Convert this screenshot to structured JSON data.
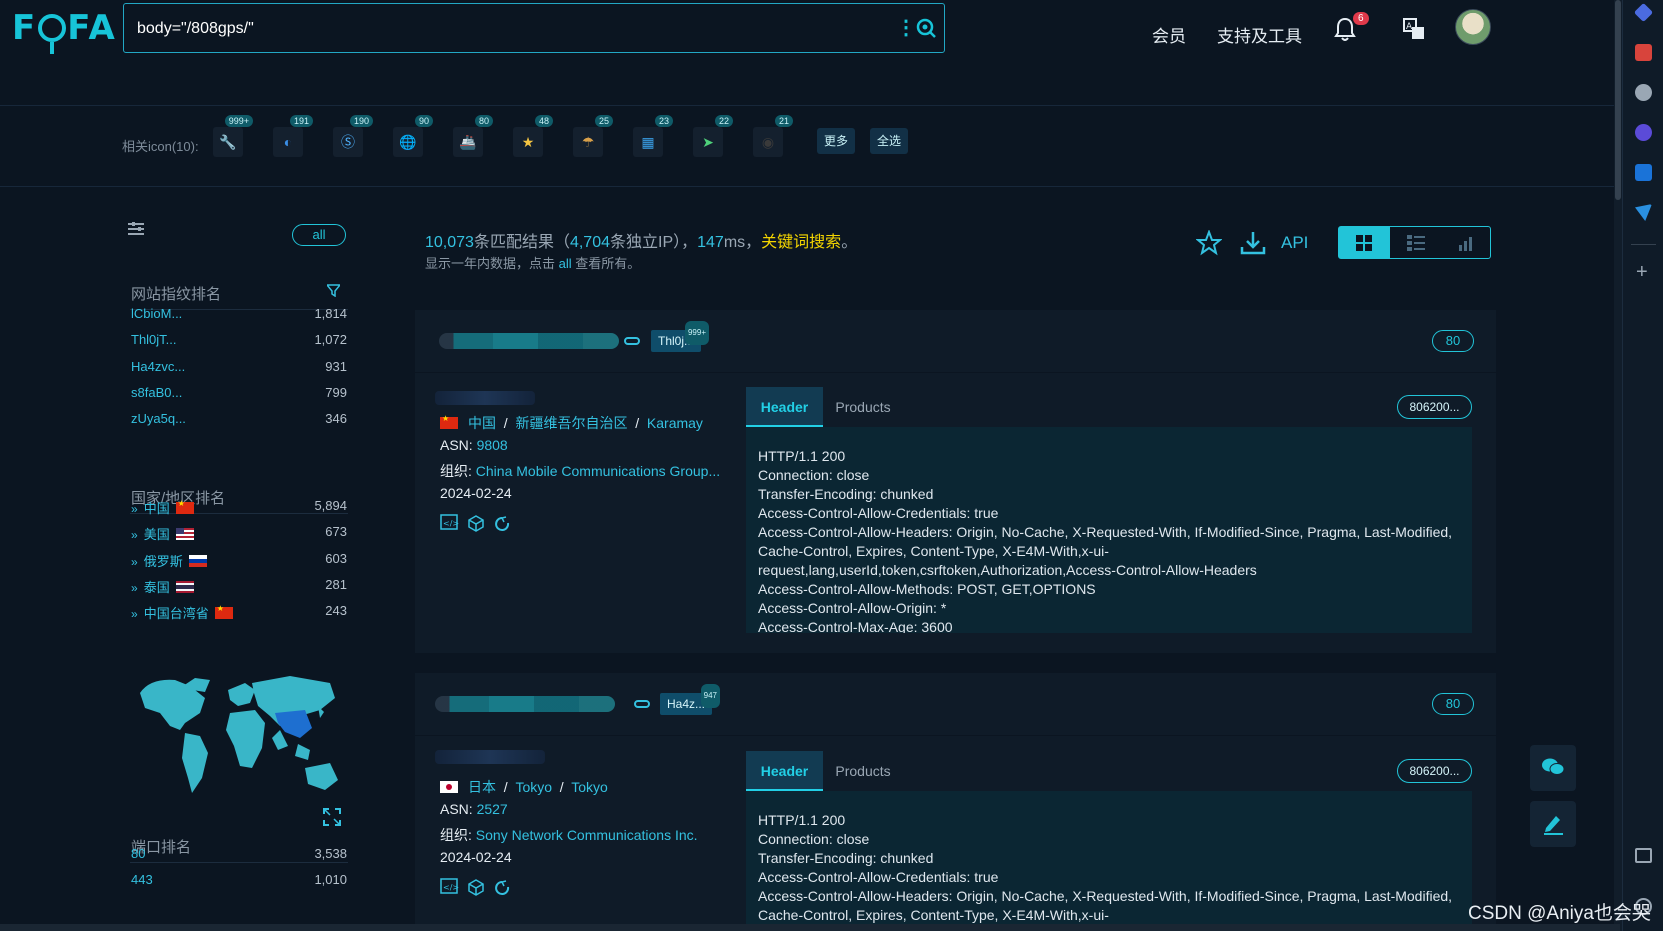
{
  "header": {
    "logo": "FOFA",
    "search_query": "body=\"/808gps/\"",
    "nav_member": "会员",
    "nav_tools": "支持及工具",
    "notification_count": "6"
  },
  "icon_strip": {
    "label": "相关icon(10):",
    "icons": [
      {
        "count": "999+",
        "glyph": "🔧",
        "color": "#c9d2dc"
      },
      {
        "count": "191",
        "glyph": "◐",
        "color": "#3a8ee6"
      },
      {
        "count": "190",
        "glyph": "Ⓢ",
        "color": "#4fb3ff"
      },
      {
        "count": "90",
        "glyph": "🌐",
        "color": "#4aa3df"
      },
      {
        "count": "80",
        "glyph": "🚢",
        "color": "#d94a4a"
      },
      {
        "count": "48",
        "glyph": "★",
        "color": "#f5c542"
      },
      {
        "count": "25",
        "glyph": "☂",
        "color": "#d8a04a"
      },
      {
        "count": "23",
        "glyph": "▦",
        "color": "#3aa0e8"
      },
      {
        "count": "22",
        "glyph": "➤",
        "color": "#4fd07a"
      },
      {
        "count": "21",
        "glyph": "◉",
        "color": "#3a3a3a"
      }
    ],
    "more_label": "更多",
    "select_all_label": "全选"
  },
  "sidebar": {
    "all_label": "all",
    "fingerprint_title": "网站指纹排名",
    "fingerprints": [
      {
        "name": "lCbioM...",
        "count": "1,814"
      },
      {
        "name": "Thl0jT...",
        "count": "1,072"
      },
      {
        "name": "Ha4zvc...",
        "count": "931"
      },
      {
        "name": "s8faB0...",
        "count": "799"
      },
      {
        "name": "zUya5q...",
        "count": "346"
      }
    ],
    "country_title": "国家/地区排名",
    "countries": [
      {
        "name": "中国",
        "count": "5,894",
        "flag": "cn"
      },
      {
        "name": "美国",
        "count": "673",
        "flag": "us"
      },
      {
        "name": "俄罗斯",
        "count": "603",
        "flag": "ru"
      },
      {
        "name": "泰国",
        "count": "281",
        "flag": "th"
      },
      {
        "name": "中国台湾省",
        "count": "243",
        "flag": "cn"
      }
    ],
    "port_title": "端口排名",
    "ports": [
      {
        "name": "80",
        "count": "3,538"
      },
      {
        "name": "443",
        "count": "1,010"
      }
    ]
  },
  "summary": {
    "total": "10,073",
    "total_suffix": "条匹配结果（",
    "ips": "4,704",
    "ips_suffix": "条独立IP），",
    "ms": "147",
    "ms_suffix": "ms，",
    "keyword_link": "关键词搜索",
    "end": "。",
    "note_prefix": "显示一年内数据，点击",
    "note_all": "all",
    "note_suffix": "查看所有。",
    "api_label": "API"
  },
  "results": [
    {
      "tag": "Thl0j...",
      "tag_count": "999+",
      "port": "80",
      "country": "中国",
      "region": "新疆维吾尔自治区",
      "city": "Karamay",
      "asn_label": "ASN:",
      "asn": "9808",
      "org_label": "组织:",
      "org": "China Mobile Communications Group...",
      "date": "2024-02-24",
      "tab_header": "Header",
      "tab_products": "Products",
      "hash": "806200...",
      "header_text": "HTTP/1.1 200\nConnection: close\nTransfer-Encoding: chunked\nAccess-Control-Allow-Credentials: true\nAccess-Control-Allow-Headers: Origin, No-Cache, X-Requested-With, If-Modified-Since, Pragma, Last-Modified, Cache-Control, Expires, Content-Type, X-E4M-With,x-ui-request,lang,userId,token,csrftoken,Authorization,Access-Control-Allow-Headers\nAccess-Control-Allow-Methods: POST, GET,OPTIONS\nAccess-Control-Allow-Origin: *\nAccess-Control-Max-Age: 3600"
    },
    {
      "tag": "Ha4z...",
      "tag_count": "947",
      "port": "80",
      "country": "日本",
      "region": "Tokyo",
      "city": "Tokyo",
      "asn_label": "ASN:",
      "asn": "2527",
      "org_label": "组织:",
      "org": "Sony Network Communications Inc.",
      "date": "2024-02-24",
      "tab_header": "Header",
      "tab_products": "Products",
      "hash": "806200...",
      "header_text": "HTTP/1.1 200\nConnection: close\nTransfer-Encoding: chunked\nAccess-Control-Allow-Credentials: true\nAccess-Control-Allow-Headers: Origin, No-Cache, X-Requested-With, If-Modified-Since, Pragma, Last-Modified, Cache-Control, Expires, Content-Type, X-E4M-With,x-ui-request,lang,userId,token,csrftoken,Authorization,Access"
    }
  ],
  "watermark": "CSDN @Aniya也会哭",
  "colors": {
    "accent": "#22c4d8",
    "keyword": "#f3d400",
    "badge": "#e0394a"
  }
}
